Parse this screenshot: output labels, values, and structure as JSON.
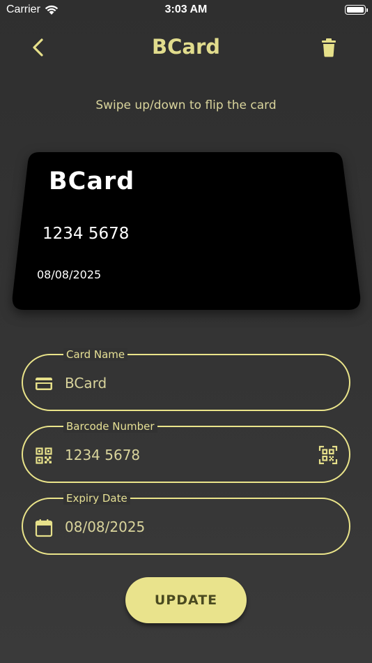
{
  "status_bar": {
    "carrier": "Carrier",
    "time": "3:03 AM"
  },
  "nav": {
    "title": "BCard",
    "back_icon": "chevron-left-icon",
    "delete_icon": "trash-icon"
  },
  "hint": "Swipe up/down to flip the card",
  "card": {
    "name": "BCard",
    "number": "1234 5678",
    "expiry": "08/08/2025"
  },
  "form": {
    "card_name": {
      "label": "Card Name",
      "value": "BCard",
      "icon": "credit-card-icon"
    },
    "barcode": {
      "label": "Barcode Number",
      "value": "1234 5678",
      "icon": "qr-code-icon",
      "action_icon": "qr-scan-icon"
    },
    "expiry": {
      "label": "Expiry Date",
      "value": "08/08/2025",
      "icon": "calendar-icon"
    }
  },
  "update_label": "UPDATE",
  "colors": {
    "accent": "#e9e38c",
    "background": "#323232",
    "card": "#000000"
  }
}
